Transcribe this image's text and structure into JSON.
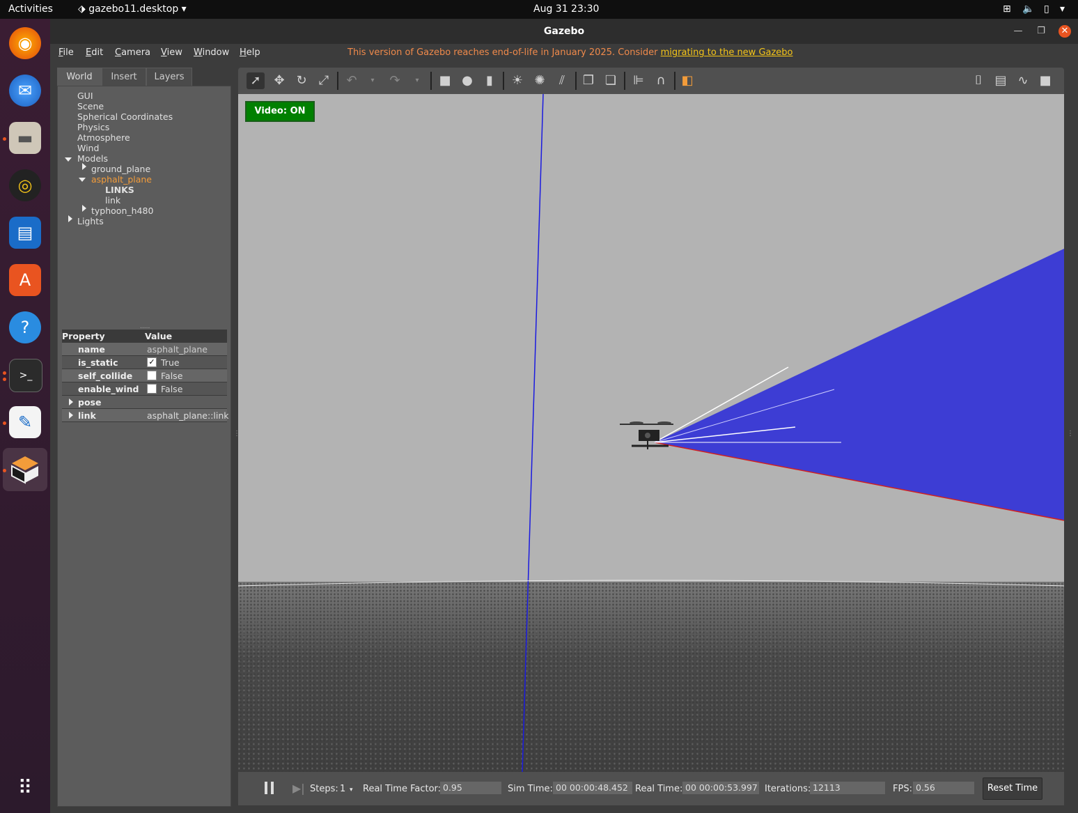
{
  "topbar": {
    "activities": "Activities",
    "app_menu": "gazebo11.desktop",
    "clock": "Aug 31  23:30"
  },
  "window": {
    "title": "Gazebo"
  },
  "menubar": {
    "items": [
      "File",
      "Edit",
      "Camera",
      "View",
      "Window",
      "Help"
    ],
    "eol_text": "This version of Gazebo reaches end-of-life in January 2025. Consider ",
    "eol_link": "migrating to the new Gazebo"
  },
  "left_tabs": [
    "World",
    "Insert",
    "Layers"
  ],
  "tree": {
    "gui": "GUI",
    "scene": "Scene",
    "spherical": "Spherical Coordinates",
    "physics": "Physics",
    "atmosphere": "Atmosphere",
    "wind": "Wind",
    "models": "Models",
    "ground_plane": "ground_plane",
    "asphalt_plane": "asphalt_plane",
    "links": "LINKS",
    "link": "link",
    "typhoon": "typhoon_h480",
    "lights": "Lights"
  },
  "properties": {
    "header_property": "Property",
    "header_value": "Value",
    "name_key": "name",
    "name_val": "asphalt_plane",
    "is_static_key": "is_static",
    "is_static_val": "True",
    "self_collide_key": "self_collide",
    "self_collide_val": "False",
    "enable_wind_key": "enable_wind",
    "enable_wind_val": "False",
    "pose_key": "pose",
    "link_key": "link",
    "link_val": "asphalt_plane::link"
  },
  "viewport": {
    "video_label": "Video: ON"
  },
  "status": {
    "steps_label": "Steps:",
    "steps_val": "1",
    "rtf_label": "Real Time Factor:",
    "rtf_val": "0.95",
    "sim_label": "Sim Time:",
    "sim_val": "00 00:00:48.452",
    "real_label": "Real Time:",
    "real_val": "00 00:00:53.997",
    "iter_label": "Iterations:",
    "iter_val": "12113",
    "fps_label": "FPS:",
    "fps_val": "0.56",
    "reset_label": "Reset Time"
  },
  "colors": {
    "accent_orange": "#e95420",
    "selected_tree": "#f39c3a",
    "video_green": "#008000",
    "laser_blue": "#3a3ad8"
  }
}
